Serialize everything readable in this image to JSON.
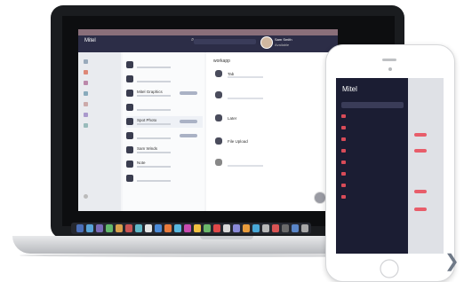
{
  "app": {
    "window_title": "Mitel",
    "contact_name": "Sam Smith",
    "contact_status": "Available"
  },
  "conversation": {
    "title": "workapp",
    "messages": [
      "Tab",
      "",
      "Later",
      "File Upload",
      ""
    ]
  },
  "list": {
    "rows": [
      "",
      "",
      "Mitel Graphics",
      "",
      "Spot Photo",
      "",
      "Sam Winds",
      "Note",
      ""
    ]
  },
  "phone": {
    "title": "Mitel",
    "menu": [
      "",
      "",
      "",
      "",
      "",
      "",
      "",
      "",
      ""
    ]
  },
  "colors": {
    "header": "#2c2d47",
    "accent": "#d84b58",
    "phone_bg": "#1b1d33"
  }
}
